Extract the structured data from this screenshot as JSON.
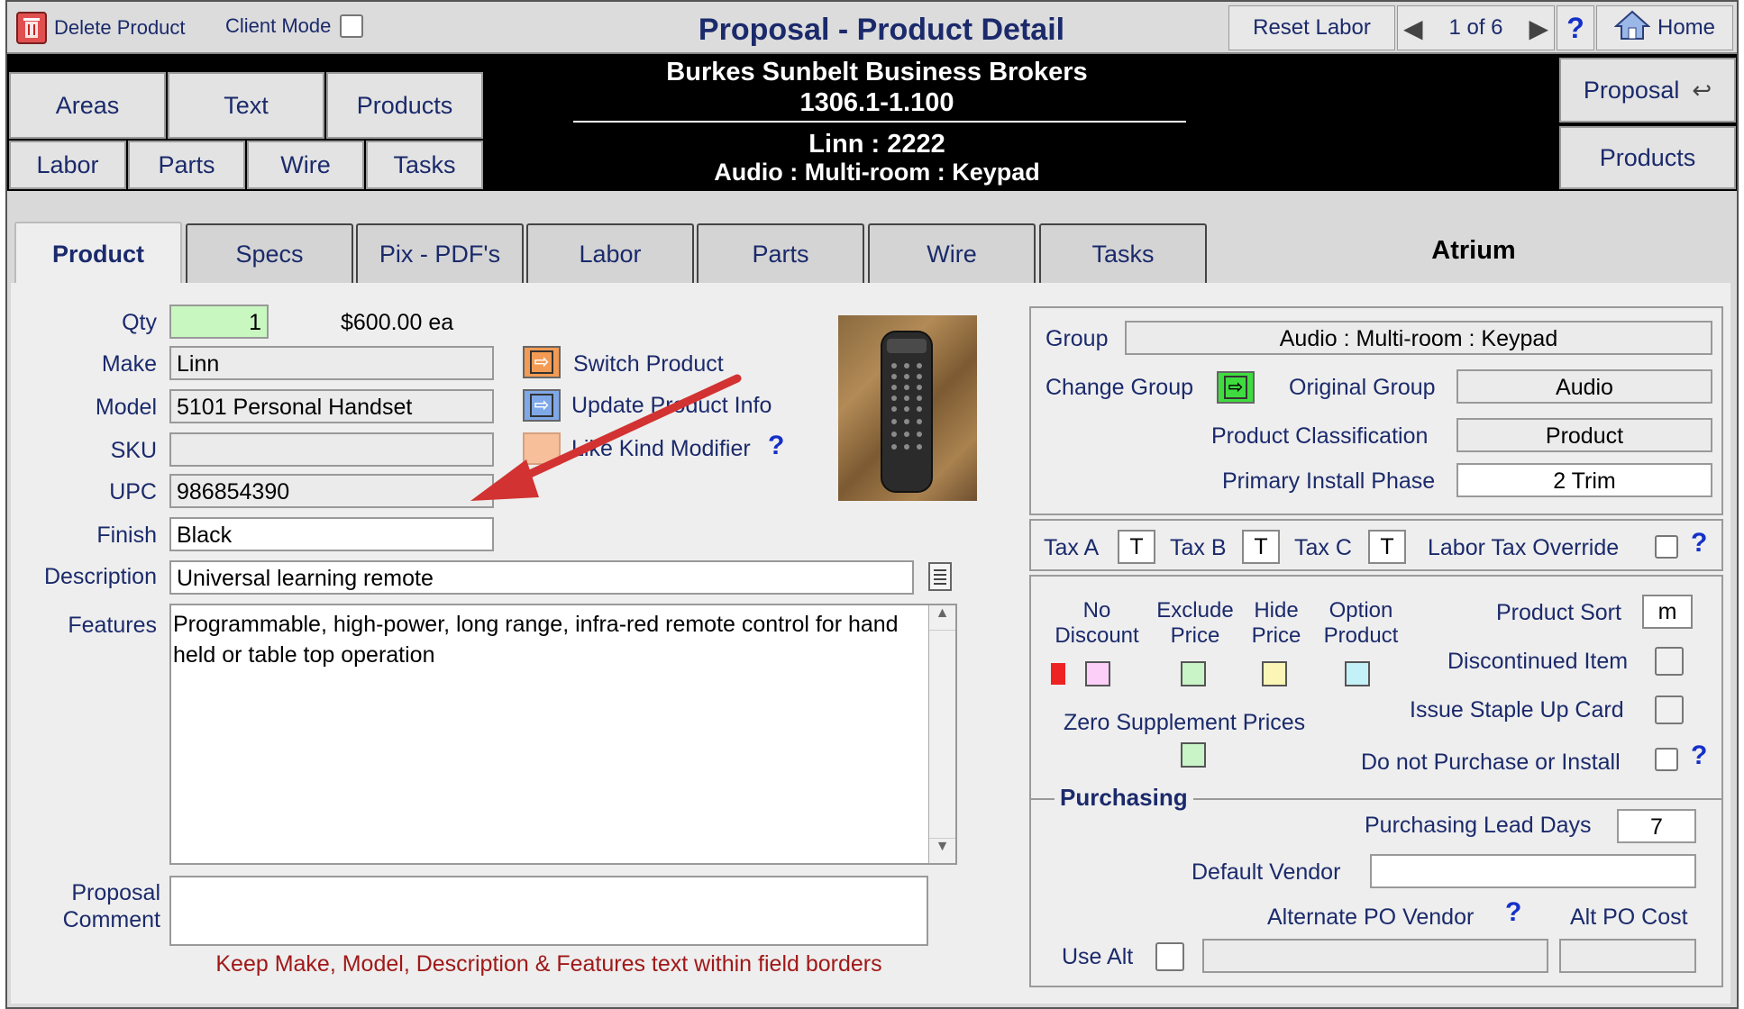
{
  "toolbar": {
    "delete_label": "Delete Product",
    "client_mode_label": "Client Mode",
    "title": "Proposal - Product Detail",
    "reset_labor": "Reset Labor",
    "record_position": "1 of 6",
    "help": "?",
    "home": "Home"
  },
  "header": {
    "client": "Burkes  Sunbelt Business Brokers",
    "proposal_number": "1306.1-1.100",
    "product_id": "Linn : 2222",
    "product_group": "Audio : Multi-room : Keypad"
  },
  "nav": {
    "areas": "Areas",
    "text": "Text",
    "products": "Products",
    "labor": "Labor",
    "parts": "Parts",
    "wire": "Wire",
    "tasks": "Tasks",
    "proposal": "Proposal",
    "products_right": "Products"
  },
  "tabs": [
    "Product",
    "Specs",
    "Pix - PDF's",
    "Labor",
    "Parts",
    "Wire",
    "Tasks"
  ],
  "area_name": "Atrium",
  "product": {
    "qty_label": "Qty",
    "qty": "1",
    "price": "$600.00 ea",
    "make_label": "Make",
    "make": "Linn",
    "model_label": "Model",
    "model": "5101 Personal Handset",
    "sku_label": "SKU",
    "sku": "",
    "upc_label": "UPC",
    "upc": "986854390",
    "finish_label": "Finish",
    "finish": "Black",
    "description_label": "Description",
    "description": "Universal learning remote",
    "features_label": "Features",
    "features": "Programmable, high-power, long range, infra-red remote control for hand held or table top operation",
    "comment_label_1": "Proposal",
    "comment_label_2": "Comment",
    "comment": "",
    "switch_product": "Switch Product",
    "update_info": "Update Product Info",
    "like_kind": "Like Kind Modifier",
    "warning": "Keep Make, Model, Description & Features text within field borders"
  },
  "group_panel": {
    "group_label": "Group",
    "group": "Audio : Multi-room : Keypad",
    "change_group": "Change Group",
    "original_group_label": "Original Group",
    "original_group": "Audio",
    "classification_label": "Product Classification",
    "classification": "Product",
    "phase_label": "Primary Install Phase",
    "phase": "2 Trim"
  },
  "tax": {
    "a_label": "Tax A",
    "a": "T",
    "b_label": "Tax B",
    "b": "T",
    "c_label": "Tax C",
    "c": "T",
    "override_label": "Labor Tax Override"
  },
  "flags": {
    "no_discount_1": "No",
    "no_discount_2": "Discount",
    "exclude_price_1": "Exclude",
    "exclude_price_2": "Price",
    "hide_price_1": "Hide",
    "hide_price_2": "Price",
    "option_product_1": "Option",
    "option_product_2": "Product",
    "zero_supplement": "Zero Supplement Prices",
    "product_sort_label": "Product Sort",
    "product_sort": "m",
    "discontinued_label": "Discontinued Item",
    "staple_up_label": "Issue Staple Up Card",
    "do_not_purchase_label": "Do not Purchase or Install"
  },
  "purchasing": {
    "section_label": "Purchasing",
    "lead_days_label": "Purchasing Lead Days",
    "lead_days": "7",
    "default_vendor_label": "Default Vendor",
    "default_vendor": "",
    "alt_vendor_label": "Alternate PO Vendor",
    "alt_cost_label": "Alt PO Cost",
    "use_alt_label": "Use Alt",
    "alt_vendor": "",
    "alt_cost": ""
  },
  "colors": {
    "title": "#1b2a6b",
    "qty_bg": "#c8f7c0",
    "annotation_arrow": "#d23232",
    "warning_text": "#a01818"
  }
}
